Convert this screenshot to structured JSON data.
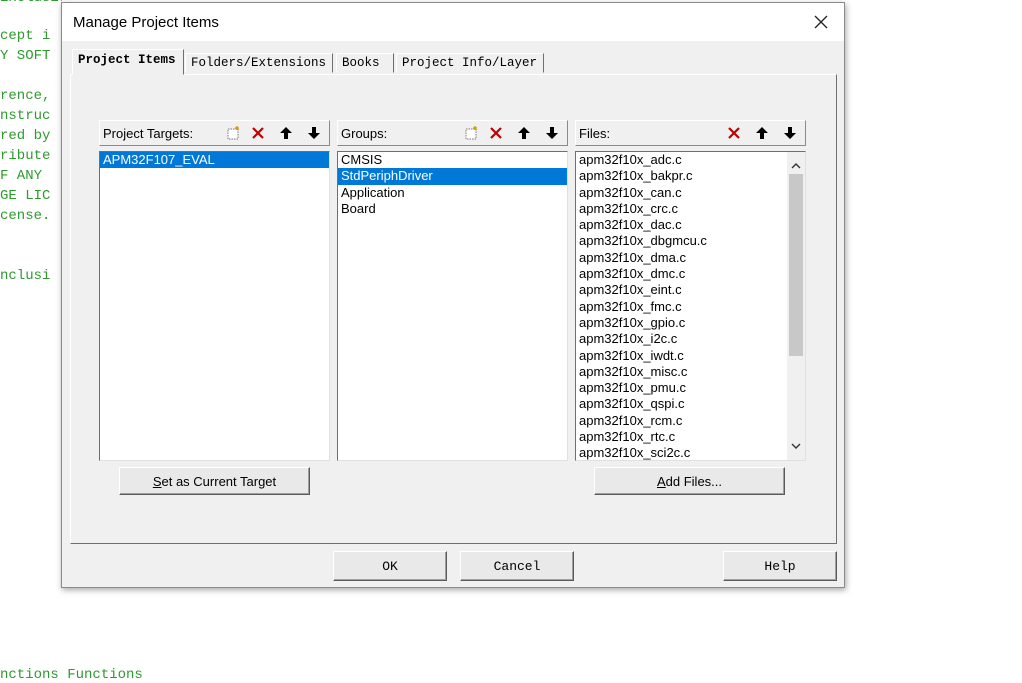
{
  "background_code": {
    "lines": [
      "cept i",
      "Y SOFT",
      "",
      "rence,",
      "nstruc",
      "red by",
      "ribute",
      "F ANY ",
      "GE LIC",
      "cense.",
      "",
      "",
      "nclusi"
    ],
    "bottom_line": "nctions Functions"
  },
  "dialog": {
    "title": "Manage Project Items",
    "tabs": [
      "Project Items",
      "Folders/Extensions",
      "Books",
      "Project Info/Layer"
    ],
    "targets": {
      "label": "Project Targets:",
      "items": [
        "APM32F107_EVAL"
      ],
      "selected": 0
    },
    "groups": {
      "label": "Groups:",
      "items": [
        "CMSIS",
        "StdPeriphDriver",
        "Application",
        "Board"
      ],
      "selected": 1
    },
    "files": {
      "label": "Files:",
      "items": [
        "apm32f10x_adc.c",
        "apm32f10x_bakpr.c",
        "apm32f10x_can.c",
        "apm32f10x_crc.c",
        "apm32f10x_dac.c",
        "apm32f10x_dbgmcu.c",
        "apm32f10x_dma.c",
        "apm32f10x_dmc.c",
        "apm32f10x_eint.c",
        "apm32f10x_fmc.c",
        "apm32f10x_gpio.c",
        "apm32f10x_i2c.c",
        "apm32f10x_iwdt.c",
        "apm32f10x_misc.c",
        "apm32f10x_pmu.c",
        "apm32f10x_qspi.c",
        "apm32f10x_rcm.c",
        "apm32f10x_rtc.c",
        "apm32f10x_sci2c.c"
      ]
    },
    "set_target_button": {
      "prefix": "S",
      "rest": "et as Current Target"
    },
    "add_files_button": {
      "prefix": "A",
      "rest": "dd Files..."
    },
    "ok": "OK",
    "cancel": "Cancel",
    "help": "Help"
  },
  "icons": {
    "new": "new-item-icon",
    "delete": "delete-icon",
    "move_up": "move-up-icon",
    "move_down": "move-down-icon"
  },
  "colors": {
    "selection": "#0078d7",
    "delete": "#c00000",
    "code_green": "#2e9a2e"
  }
}
